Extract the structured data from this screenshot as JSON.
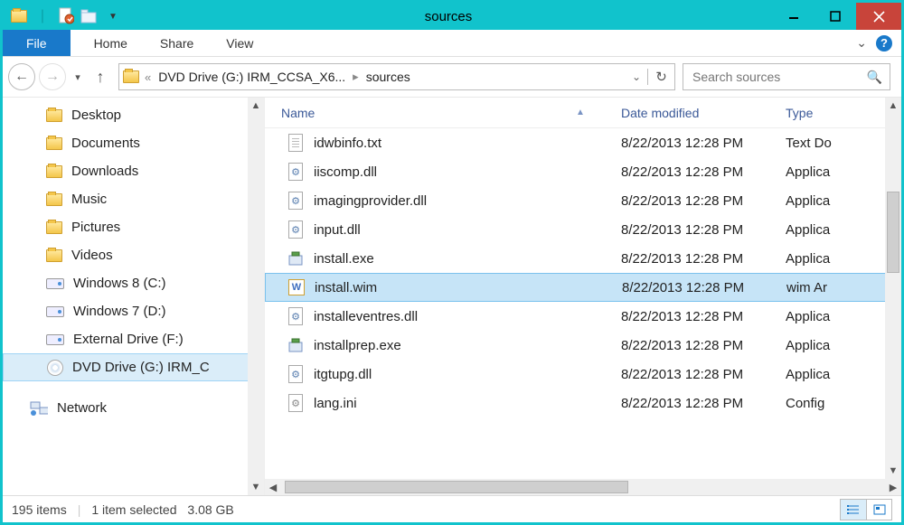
{
  "window": {
    "title": "sources"
  },
  "tabs": {
    "file": "File",
    "home": "Home",
    "share": "Share",
    "view": "View"
  },
  "breadcrumb": {
    "drive": "DVD Drive (G:) IRM_CCSA_X6...",
    "folder": "sources"
  },
  "search": {
    "placeholder": "Search sources"
  },
  "columns": {
    "name": "Name",
    "date": "Date modified",
    "type": "Type"
  },
  "tree": [
    {
      "label": "Desktop",
      "icon": "folder"
    },
    {
      "label": "Documents",
      "icon": "folder"
    },
    {
      "label": "Downloads",
      "icon": "folder"
    },
    {
      "label": "Music",
      "icon": "folder"
    },
    {
      "label": "Pictures",
      "icon": "folder"
    },
    {
      "label": "Videos",
      "icon": "folder"
    },
    {
      "label": "Windows 8 (C:)",
      "icon": "drive"
    },
    {
      "label": "Windows 7 (D:)",
      "icon": "drive"
    },
    {
      "label": "External Drive (F:)",
      "icon": "drive"
    },
    {
      "label": "DVD Drive (G:) IRM_C",
      "icon": "dvd",
      "selected": true
    }
  ],
  "network_label": "Network",
  "files": [
    {
      "name": "idwbinfo.txt",
      "date": "8/22/2013 12:28 PM",
      "type": "Text Do",
      "icon": "txt"
    },
    {
      "name": "iiscomp.dll",
      "date": "8/22/2013 12:28 PM",
      "type": "Applica",
      "icon": "dll"
    },
    {
      "name": "imagingprovider.dll",
      "date": "8/22/2013 12:28 PM",
      "type": "Applica",
      "icon": "dll"
    },
    {
      "name": "input.dll",
      "date": "8/22/2013 12:28 PM",
      "type": "Applica",
      "icon": "dll"
    },
    {
      "name": "install.exe",
      "date": "8/22/2013 12:28 PM",
      "type": "Applica",
      "icon": "exe"
    },
    {
      "name": "install.wim",
      "date": "8/22/2013 12:28 PM",
      "type": "wim Ar",
      "icon": "wim",
      "selected": true
    },
    {
      "name": "installeventres.dll",
      "date": "8/22/2013 12:28 PM",
      "type": "Applica",
      "icon": "dll"
    },
    {
      "name": "installprep.exe",
      "date": "8/22/2013 12:28 PM",
      "type": "Applica",
      "icon": "exe"
    },
    {
      "name": "itgtupg.dll",
      "date": "8/22/2013 12:28 PM",
      "type": "Applica",
      "icon": "dll"
    },
    {
      "name": "lang.ini",
      "date": "8/22/2013 12:28 PM",
      "type": "Config",
      "icon": "ini"
    }
  ],
  "status": {
    "count": "195 items",
    "selection": "1 item selected",
    "size": "3.08 GB"
  }
}
